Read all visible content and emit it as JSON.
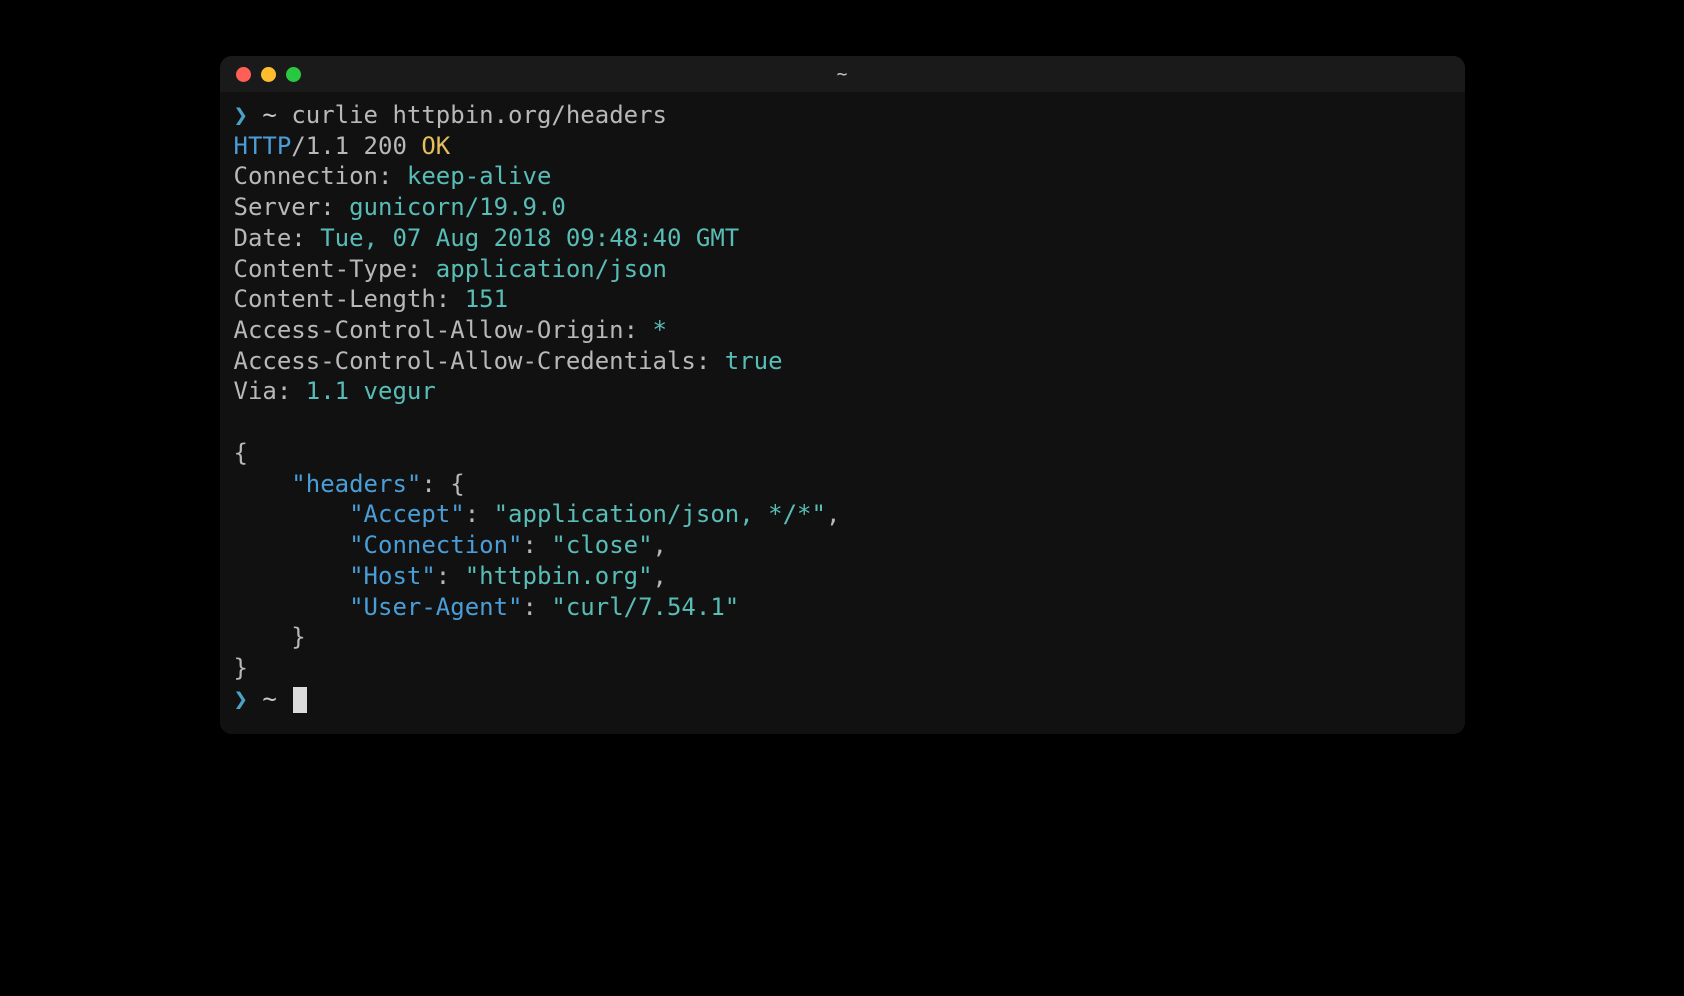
{
  "window": {
    "title": "~"
  },
  "prompt": {
    "caret": "❯",
    "path": "~",
    "command": "curlie httpbin.org/headers"
  },
  "status_line": {
    "protocol": "HTTP",
    "version": "/1.1",
    "code": "200",
    "text": "OK"
  },
  "response_headers": [
    {
      "name": "Connection:",
      "value": "keep-alive"
    },
    {
      "name": "Server:",
      "value": "gunicorn/19.9.0"
    },
    {
      "name": "Date:",
      "value": "Tue, 07 Aug 2018 09:48:40 GMT"
    },
    {
      "name": "Content-Type:",
      "value": "application/json"
    },
    {
      "name": "Content-Length:",
      "value": "151"
    },
    {
      "name": "Access-Control-Allow-Origin:",
      "value": "*"
    },
    {
      "name": "Access-Control-Allow-Credentials:",
      "value": "true"
    },
    {
      "name": "Via:",
      "value": "1.1 vegur"
    }
  ],
  "body": {
    "open": "{",
    "headers_key": "\"headers\"",
    "headers_open": ": {",
    "entries": [
      {
        "key": "\"Accept\"",
        "value": "\"application/json, */*\"",
        "comma": ","
      },
      {
        "key": "\"Connection\"",
        "value": "\"close\"",
        "comma": ","
      },
      {
        "key": "\"Host\"",
        "value": "\"httpbin.org\"",
        "comma": ","
      },
      {
        "key": "\"User-Agent\"",
        "value": "\"curl/7.54.1\"",
        "comma": ""
      }
    ],
    "inner_close": "    }",
    "close": "}"
  },
  "indent": {
    "k1": "    ",
    "k2": "        "
  }
}
